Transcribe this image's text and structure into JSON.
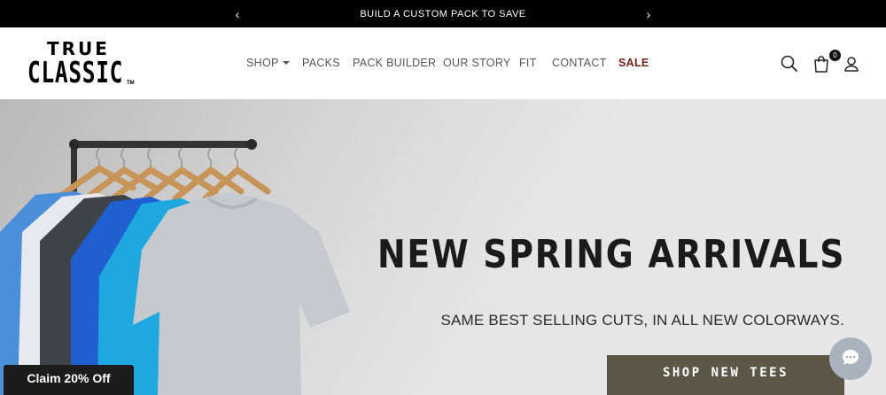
{
  "announcement": {
    "text": "BUILD A CUSTOM PACK TO SAVE",
    "prev_icon": "‹",
    "next_icon": "›"
  },
  "header": {
    "logo": {
      "line1": "TRUE",
      "line2": "CLASSIC",
      "tm": "TM"
    },
    "nav": [
      {
        "label": "SHOP"
      },
      {
        "label": "PACKS"
      },
      {
        "label": "PACK BUILDER"
      },
      {
        "label": "OUR STORY"
      },
      {
        "label": "FIT"
      },
      {
        "label": "CONTACT"
      },
      {
        "label": "SALE"
      }
    ],
    "icons": [
      "search-icon",
      "cart-icon",
      "account-icon"
    ],
    "cart_count": "0"
  },
  "hero": {
    "title": "NEW SPRING ARRIVALS",
    "subtitle": "SAME BEST SELLING CUTS, IN ALL NEW COLORWAYS.",
    "cta": "SHOP NEW TEES"
  },
  "popup": {
    "claim_label": "Claim 20% Off"
  },
  "colors": {
    "announcement_bg": "#000000",
    "sale": "#6d2418",
    "cta_bg": "#5b5747",
    "chat_bg": "#a9b3bd"
  }
}
